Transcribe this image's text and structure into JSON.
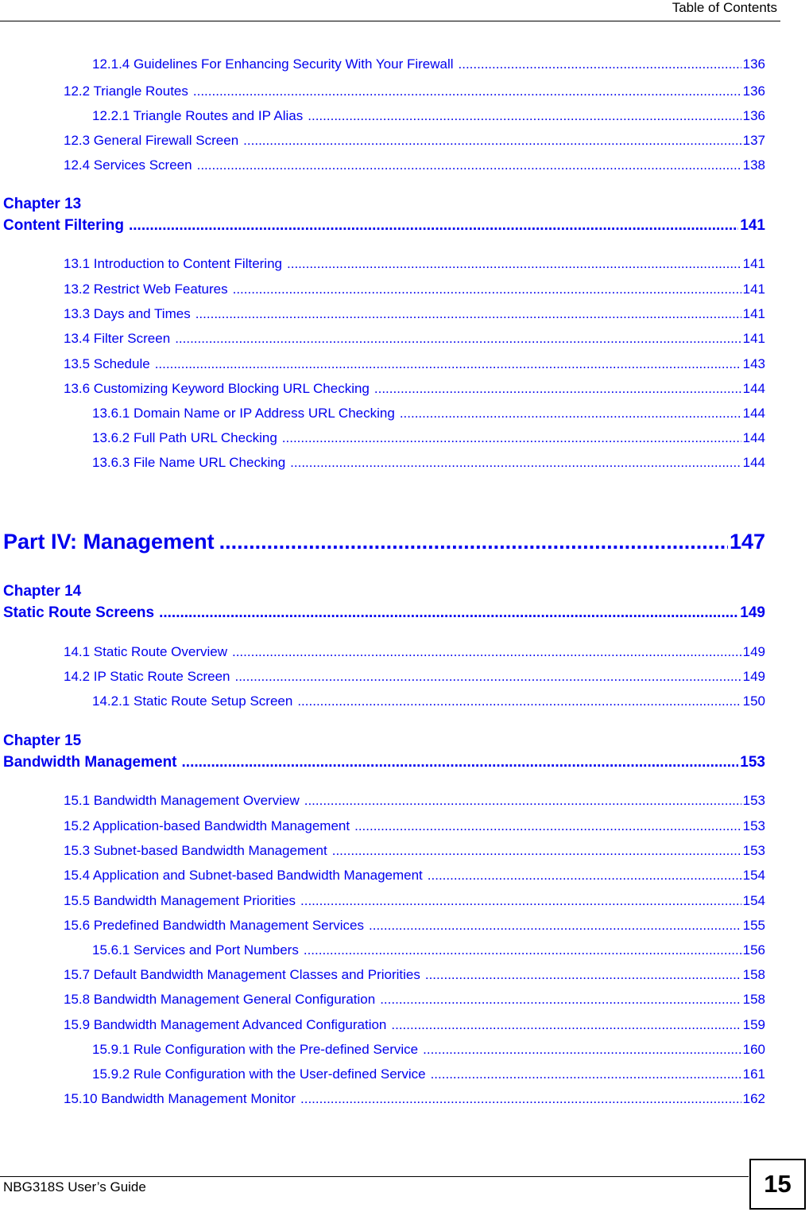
{
  "header": {
    "title": "Table of Contents"
  },
  "footer": {
    "guide_title": "NBG318S User’s Guide",
    "page_number": "15"
  },
  "toc": {
    "e1": {
      "title": "12.1.4 Guidelines For Enhancing Security With Your Firewall",
      "page": "136"
    },
    "e2": {
      "title": "12.2 Triangle Routes",
      "page": "136"
    },
    "e3": {
      "title": "12.2.1 Triangle Routes and IP Alias",
      "page": "136"
    },
    "e4": {
      "title": "12.3 General Firewall Screen",
      "page": "137"
    },
    "e5": {
      "title": "12.4 Services Screen",
      "page": "138"
    },
    "ch13_label": "Chapter  13",
    "ch13": {
      "title": "Content Filtering",
      "page": "141"
    },
    "e6": {
      "title": "13.1 Introduction to Content Filtering",
      "page": "141"
    },
    "e7": {
      "title": "13.2 Restrict Web Features",
      "page": "141"
    },
    "e8": {
      "title": "13.3 Days and Times",
      "page": "141"
    },
    "e9": {
      "title": "13.4 Filter Screen",
      "page": "141"
    },
    "e10": {
      "title": "13.5 Schedule",
      "page": "143"
    },
    "e11": {
      "title": "13.6 Customizing Keyword Blocking URL Checking",
      "page": "144"
    },
    "e12": {
      "title": "13.6.1 Domain Name or IP Address URL Checking",
      "page": "144"
    },
    "e13": {
      "title": "13.6.2 Full Path URL Checking",
      "page": "144"
    },
    "e14": {
      "title": "13.6.3 File Name URL Checking",
      "page": "144"
    },
    "part4": {
      "title": "Part IV: Management",
      "page": "147"
    },
    "ch14_label": "Chapter  14",
    "ch14": {
      "title": "Static Route Screens",
      "page": "149"
    },
    "e15": {
      "title": "14.1 Static Route Overview",
      "page": "149"
    },
    "e16": {
      "title": "14.2 IP Static Route Screen",
      "page": "149"
    },
    "e17": {
      "title": "14.2.1 Static Route Setup Screen",
      "page": "150"
    },
    "ch15_label": "Chapter  15",
    "ch15": {
      "title": "Bandwidth Management",
      "page": "153"
    },
    "e18": {
      "title": "15.1 Bandwidth Management Overview",
      "page": "153"
    },
    "e19": {
      "title": "15.2 Application-based Bandwidth Management",
      "page": "153"
    },
    "e20": {
      "title": "15.3 Subnet-based Bandwidth Management",
      "page": "153"
    },
    "e21": {
      "title": "15.4 Application and Subnet-based Bandwidth Management",
      "page": "154"
    },
    "e22": {
      "title": "15.5 Bandwidth Management Priorities",
      "page": "154"
    },
    "e23": {
      "title": "15.6 Predefined Bandwidth Management Services",
      "page": "155"
    },
    "e24": {
      "title": "15.6.1 Services and Port Numbers",
      "page": "156"
    },
    "e25": {
      "title": "15.7 Default Bandwidth Management Classes and Priorities",
      "page": "158"
    },
    "e26": {
      "title": "15.8 Bandwidth Management General Configuration",
      "page": "158"
    },
    "e27": {
      "title": "15.9 Bandwidth Management Advanced Configuration",
      "page": "159"
    },
    "e28": {
      "title": "15.9.1 Rule Configuration with the Pre-defined Service",
      "page": "160"
    },
    "e29": {
      "title": "15.9.2 Rule Configuration with the User-defined Service",
      "page": "161"
    },
    "e30": {
      "title": "15.10 Bandwidth Management Monitor",
      "page": "162"
    }
  }
}
